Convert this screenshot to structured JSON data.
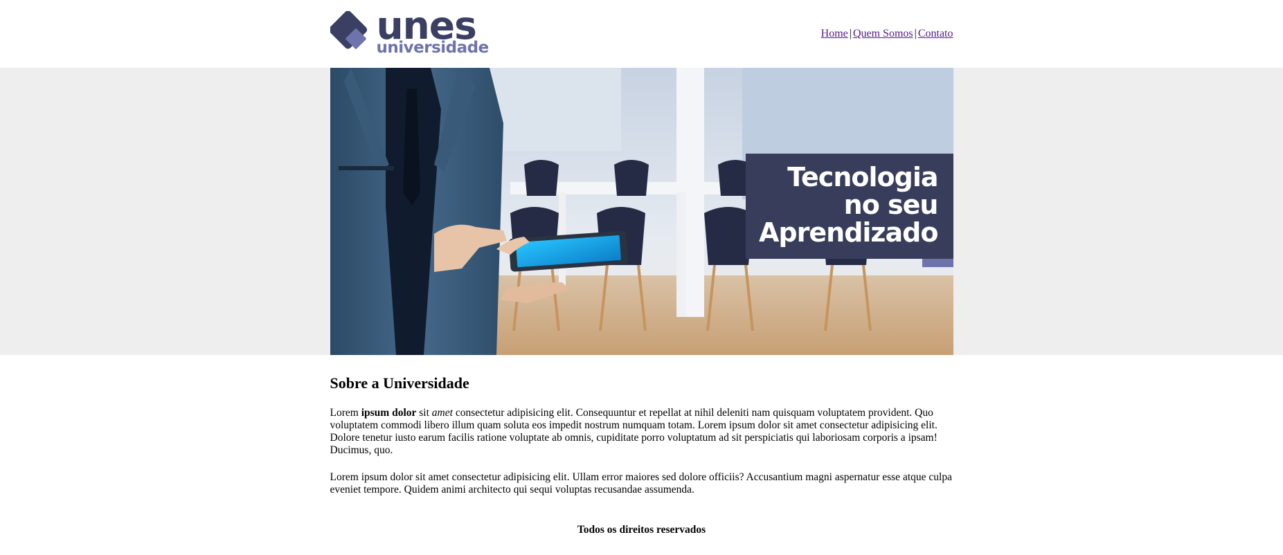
{
  "logo": {
    "word": "unes",
    "sub": "universidade",
    "icon": "diamond-logo-icon",
    "colors": {
      "dark": "#3a3f63",
      "light": "#6e73ac"
    }
  },
  "nav": {
    "items": [
      {
        "label": "Home"
      },
      {
        "label": "Quem Somos"
      },
      {
        "label": "Contato"
      }
    ],
    "separator": "|",
    "link_color": "#551a8b"
  },
  "banner": {
    "lines": [
      "Tecnologia",
      "no seu",
      "Aprendizado"
    ],
    "box_color": "#383d5b",
    "band_color": "#eeeeee"
  },
  "about": {
    "title": "Sobre a Universidade",
    "p1": {
      "w1": "Lorem ",
      "bold": "ipsum dolor",
      "w2": " sit ",
      "italic": "amet",
      "rest": " consectetur adipisicing elit. Consequuntur et repellat at nihil deleniti nam quisquam voluptatem provident. Quo voluptatem commodi libero illum quam soluta eos impedit nostrum numquam totam. Lorem ipsum dolor sit amet consectetur adipisicing elit. Dolore tenetur iusto earum facilis ratione voluptate ab omnis, cupiditate porro voluptatum ad sit perspiciatis qui laboriosam corporis a ipsam! Ducimus, quo."
    },
    "p2": "Lorem ipsum dolor sit amet consectetur adipisicing elit. Ullam error maiores sed dolore officiis? Accusantium magni aspernatur esse atque culpa eveniet tempore. Quidem animi architecto qui sequi voluptas recusandae assumenda."
  },
  "footer": {
    "text": "Todos os direitos reservados"
  }
}
